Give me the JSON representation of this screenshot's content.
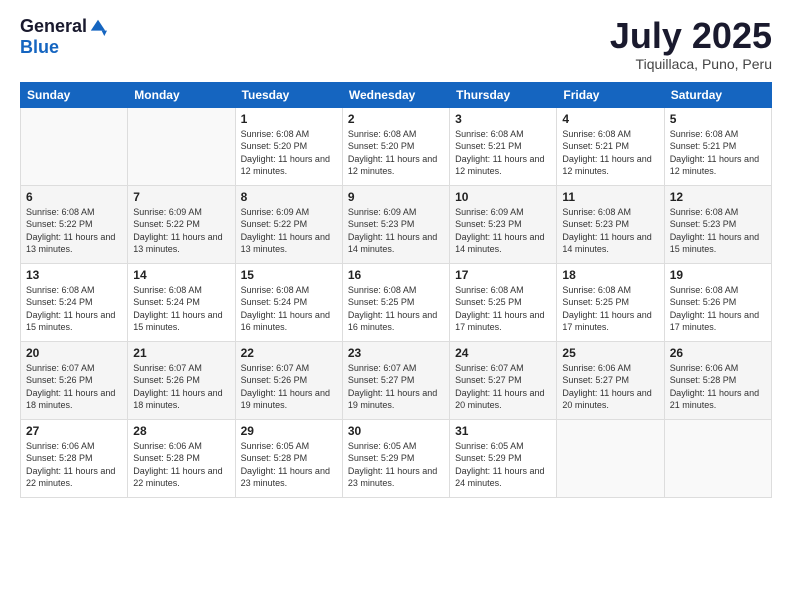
{
  "logo": {
    "general": "General",
    "blue": "Blue"
  },
  "header": {
    "month": "July 2025",
    "location": "Tiquillaca, Puno, Peru"
  },
  "weekdays": [
    "Sunday",
    "Monday",
    "Tuesday",
    "Wednesday",
    "Thursday",
    "Friday",
    "Saturday"
  ],
  "weeks": [
    [
      {
        "day": "",
        "info": ""
      },
      {
        "day": "",
        "info": ""
      },
      {
        "day": "1",
        "info": "Sunrise: 6:08 AM\nSunset: 5:20 PM\nDaylight: 11 hours and 12 minutes."
      },
      {
        "day": "2",
        "info": "Sunrise: 6:08 AM\nSunset: 5:20 PM\nDaylight: 11 hours and 12 minutes."
      },
      {
        "day": "3",
        "info": "Sunrise: 6:08 AM\nSunset: 5:21 PM\nDaylight: 11 hours and 12 minutes."
      },
      {
        "day": "4",
        "info": "Sunrise: 6:08 AM\nSunset: 5:21 PM\nDaylight: 11 hours and 12 minutes."
      },
      {
        "day": "5",
        "info": "Sunrise: 6:08 AM\nSunset: 5:21 PM\nDaylight: 11 hours and 12 minutes."
      }
    ],
    [
      {
        "day": "6",
        "info": "Sunrise: 6:08 AM\nSunset: 5:22 PM\nDaylight: 11 hours and 13 minutes."
      },
      {
        "day": "7",
        "info": "Sunrise: 6:09 AM\nSunset: 5:22 PM\nDaylight: 11 hours and 13 minutes."
      },
      {
        "day": "8",
        "info": "Sunrise: 6:09 AM\nSunset: 5:22 PM\nDaylight: 11 hours and 13 minutes."
      },
      {
        "day": "9",
        "info": "Sunrise: 6:09 AM\nSunset: 5:23 PM\nDaylight: 11 hours and 14 minutes."
      },
      {
        "day": "10",
        "info": "Sunrise: 6:09 AM\nSunset: 5:23 PM\nDaylight: 11 hours and 14 minutes."
      },
      {
        "day": "11",
        "info": "Sunrise: 6:08 AM\nSunset: 5:23 PM\nDaylight: 11 hours and 14 minutes."
      },
      {
        "day": "12",
        "info": "Sunrise: 6:08 AM\nSunset: 5:23 PM\nDaylight: 11 hours and 15 minutes."
      }
    ],
    [
      {
        "day": "13",
        "info": "Sunrise: 6:08 AM\nSunset: 5:24 PM\nDaylight: 11 hours and 15 minutes."
      },
      {
        "day": "14",
        "info": "Sunrise: 6:08 AM\nSunset: 5:24 PM\nDaylight: 11 hours and 15 minutes."
      },
      {
        "day": "15",
        "info": "Sunrise: 6:08 AM\nSunset: 5:24 PM\nDaylight: 11 hours and 16 minutes."
      },
      {
        "day": "16",
        "info": "Sunrise: 6:08 AM\nSunset: 5:25 PM\nDaylight: 11 hours and 16 minutes."
      },
      {
        "day": "17",
        "info": "Sunrise: 6:08 AM\nSunset: 5:25 PM\nDaylight: 11 hours and 17 minutes."
      },
      {
        "day": "18",
        "info": "Sunrise: 6:08 AM\nSunset: 5:25 PM\nDaylight: 11 hours and 17 minutes."
      },
      {
        "day": "19",
        "info": "Sunrise: 6:08 AM\nSunset: 5:26 PM\nDaylight: 11 hours and 17 minutes."
      }
    ],
    [
      {
        "day": "20",
        "info": "Sunrise: 6:07 AM\nSunset: 5:26 PM\nDaylight: 11 hours and 18 minutes."
      },
      {
        "day": "21",
        "info": "Sunrise: 6:07 AM\nSunset: 5:26 PM\nDaylight: 11 hours and 18 minutes."
      },
      {
        "day": "22",
        "info": "Sunrise: 6:07 AM\nSunset: 5:26 PM\nDaylight: 11 hours and 19 minutes."
      },
      {
        "day": "23",
        "info": "Sunrise: 6:07 AM\nSunset: 5:27 PM\nDaylight: 11 hours and 19 minutes."
      },
      {
        "day": "24",
        "info": "Sunrise: 6:07 AM\nSunset: 5:27 PM\nDaylight: 11 hours and 20 minutes."
      },
      {
        "day": "25",
        "info": "Sunrise: 6:06 AM\nSunset: 5:27 PM\nDaylight: 11 hours and 20 minutes."
      },
      {
        "day": "26",
        "info": "Sunrise: 6:06 AM\nSunset: 5:28 PM\nDaylight: 11 hours and 21 minutes."
      }
    ],
    [
      {
        "day": "27",
        "info": "Sunrise: 6:06 AM\nSunset: 5:28 PM\nDaylight: 11 hours and 22 minutes."
      },
      {
        "day": "28",
        "info": "Sunrise: 6:06 AM\nSunset: 5:28 PM\nDaylight: 11 hours and 22 minutes."
      },
      {
        "day": "29",
        "info": "Sunrise: 6:05 AM\nSunset: 5:28 PM\nDaylight: 11 hours and 23 minutes."
      },
      {
        "day": "30",
        "info": "Sunrise: 6:05 AM\nSunset: 5:29 PM\nDaylight: 11 hours and 23 minutes."
      },
      {
        "day": "31",
        "info": "Sunrise: 6:05 AM\nSunset: 5:29 PM\nDaylight: 11 hours and 24 minutes."
      },
      {
        "day": "",
        "info": ""
      },
      {
        "day": "",
        "info": ""
      }
    ]
  ]
}
